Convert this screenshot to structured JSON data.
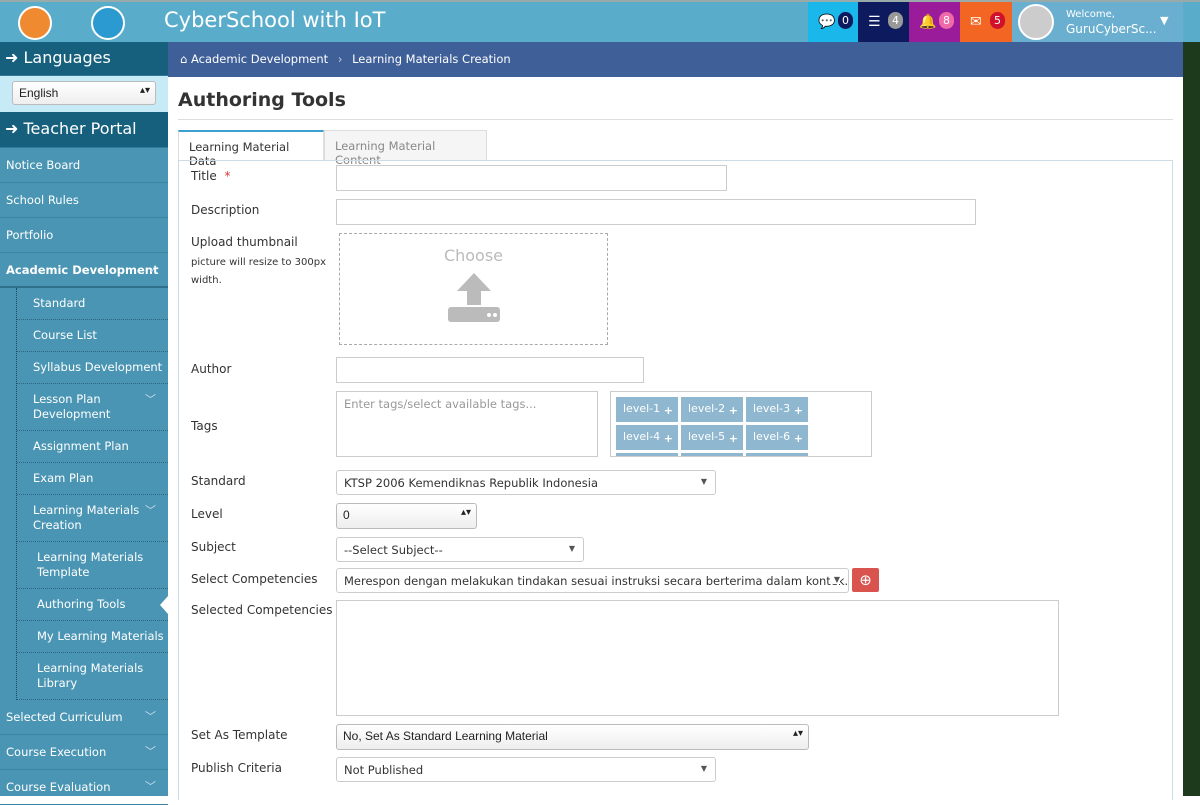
{
  "header": {
    "title": "CyberSchool with IoT",
    "welcome": "Welcome,",
    "username": "GuruCyberSc...",
    "notifications": [
      {
        "icon": "chat-icon",
        "count": "0",
        "bg": "#1ab7ea",
        "badge": "#0e1a5e"
      },
      {
        "icon": "tasks-icon",
        "count": "4",
        "bg": "#0e1a5e",
        "badge": "#999"
      },
      {
        "icon": "bell-icon",
        "count": "8",
        "bg": "#9b1c9b",
        "badge": "#ef6aa8"
      },
      {
        "icon": "envelope-icon",
        "count": "5",
        "bg": "#f26522",
        "badge": "#d0112b"
      }
    ]
  },
  "sidebar": {
    "languages_title": "Languages",
    "language": "English",
    "portal_title": "Teacher Portal",
    "items": [
      "Notice Board",
      "School Rules",
      "Portfolio",
      "Academic Development"
    ],
    "sub": [
      "Standard",
      "Course List",
      "Syllabus Development",
      "Lesson Plan Development",
      "Assignment Plan",
      "Exam Plan",
      "Learning Materials Creation"
    ],
    "subsub": [
      "Learning Materials Template",
      "Authoring Tools",
      "My Learning Materials",
      "Learning Materials Library"
    ],
    "bottom": [
      "Selected Curriculum",
      "Course Execution",
      "Course Evaluation"
    ]
  },
  "breadcrumb": [
    "Academic Development",
    "Learning Materials Creation"
  ],
  "page": {
    "title": "Authoring Tools",
    "tabs": [
      "Learning Material Data",
      "Learning Material Content"
    ]
  },
  "form": {
    "title_label": "Title",
    "required": "*",
    "description_label": "Description",
    "upload_label": "Upload thumbnail",
    "upload_hint": "picture will resize to 300px width.",
    "choose": "Choose",
    "author_label": "Author",
    "tags_label": "Tags",
    "tags_placeholder": "Enter tags/select available tags...",
    "tags": [
      "level-1",
      "level-2",
      "level-3",
      "level-4",
      "level-5",
      "level-6"
    ],
    "standard_label": "Standard",
    "standard_value": "KTSP 2006 Kemendiknas Republik Indonesia",
    "level_label": "Level",
    "level_value": "0",
    "subject_label": "Subject",
    "subject_value": "--Select Subject--",
    "competencies_label": "Select Competencies",
    "competencies_value": "Merespon dengan melakukan tindakan sesuai instruksi secara berterima dalam kontek...",
    "selected_label": "Selected Competencies",
    "template_label": "Set As Template",
    "template_value": "No, Set As Standard Learning Material",
    "publish_label": "Publish Criteria",
    "publish_value": "Not Published"
  }
}
